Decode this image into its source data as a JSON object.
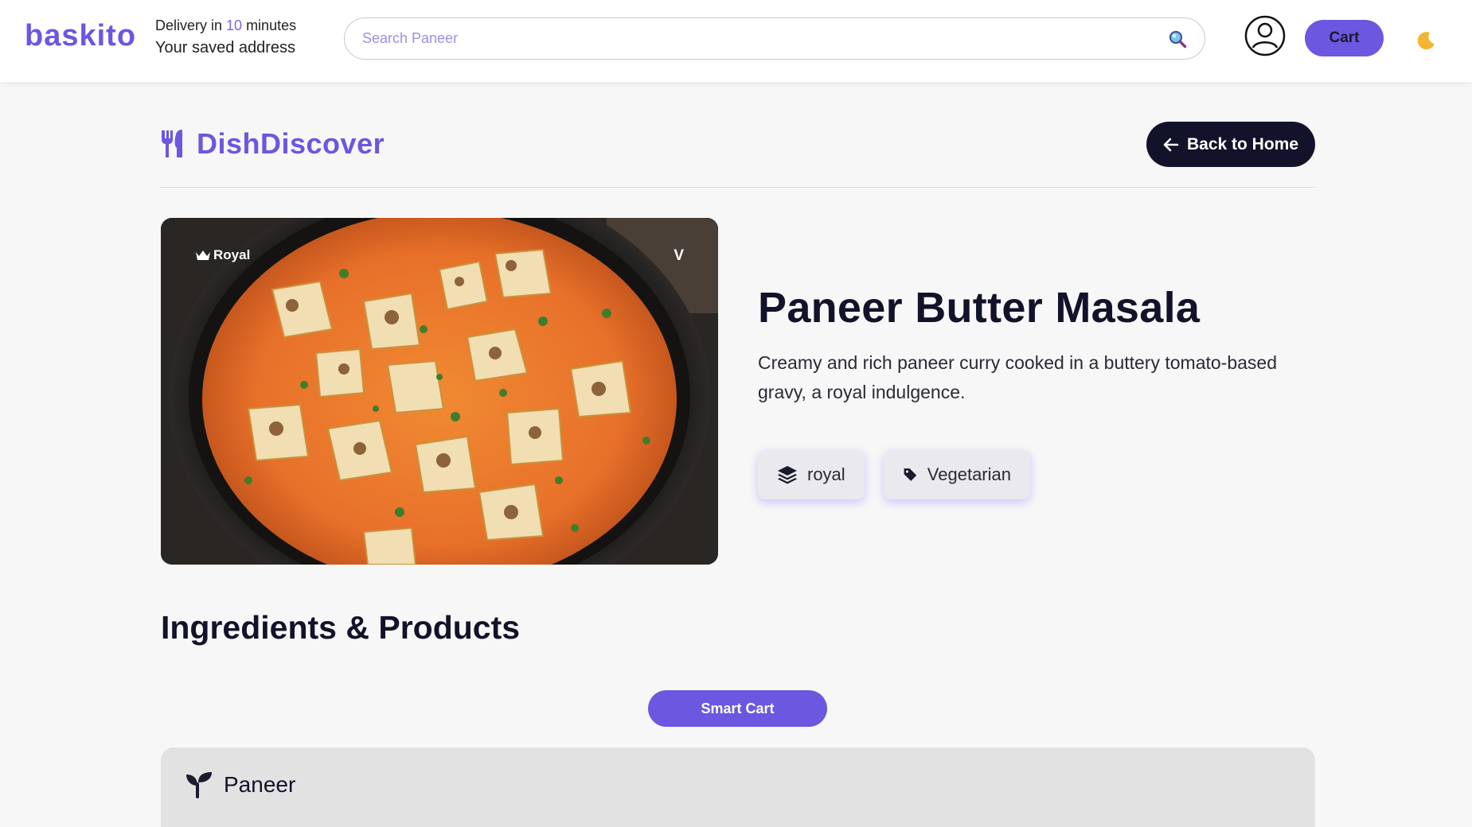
{
  "header": {
    "logo": "baskito",
    "delivery_prefix": "Delivery in ",
    "delivery_minutes": "10",
    "delivery_suffix": " minutes",
    "address": "Your saved address",
    "search_placeholder": "Search Paneer",
    "cart_label": "Cart"
  },
  "page": {
    "brand": "DishDiscover",
    "back_label": "Back to Home"
  },
  "dish": {
    "badge": "Royal",
    "veg_marker": "V",
    "title": "Paneer Butter Masala",
    "description": "Creamy and rich paneer curry cooked in a buttery tomato-based gravy, a royal indulgence.",
    "tags": [
      {
        "label": "royal",
        "icon": "layers-icon"
      },
      {
        "label": "Vegetarian",
        "icon": "tag-icon"
      }
    ]
  },
  "ingredients": {
    "title": "Ingredients & Products",
    "smart_cart_label": "Smart Cart",
    "items": [
      {
        "name": "Paneer",
        "icon": "seedling-icon"
      }
    ]
  },
  "colors": {
    "accent": "#6b57e0",
    "dark": "#12132a",
    "background": "#f7f7f7"
  }
}
